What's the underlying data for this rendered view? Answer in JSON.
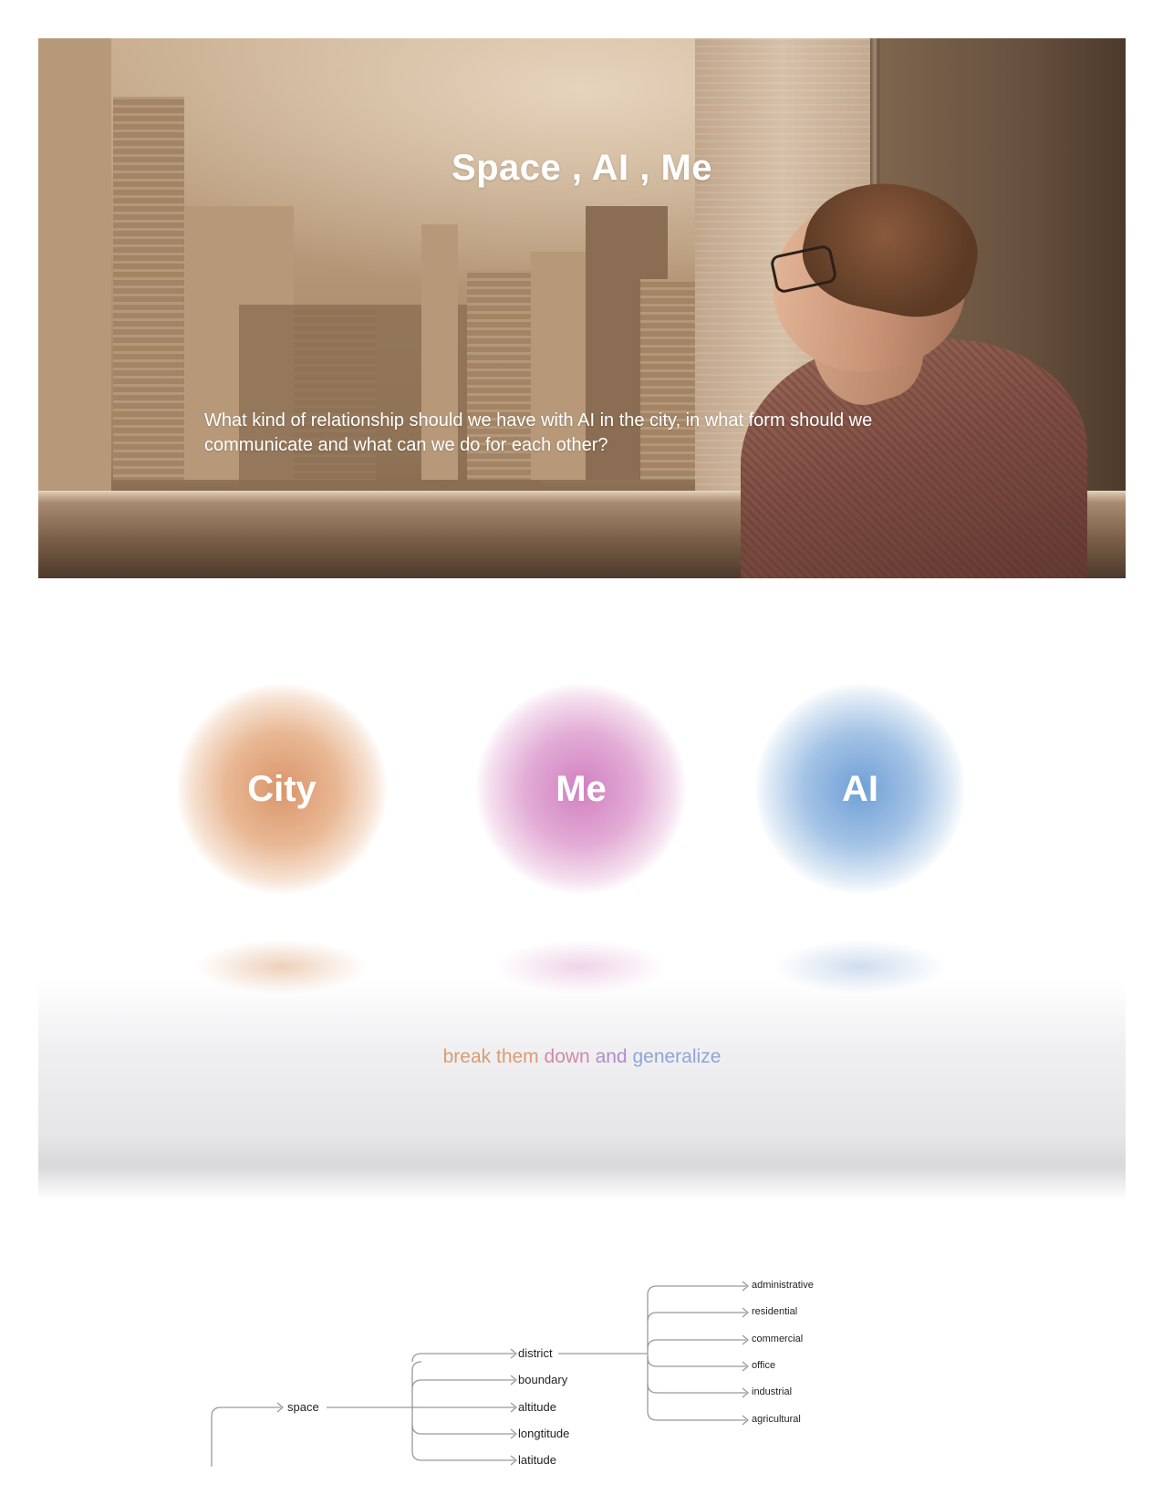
{
  "hero": {
    "title": "Space , AI , Me",
    "question": "What kind of relationship should we have with AI in the city, in what form should we communicate and what can we do for each other?"
  },
  "orbs": [
    {
      "label": "City",
      "color": "#d9956a"
    },
    {
      "label": "Me",
      "color": "#d080c0"
    },
    {
      "label": "AI",
      "color": "#6f9fd6"
    }
  ],
  "tagline": {
    "parts": [
      "break them",
      "down",
      "and",
      "generalize"
    ]
  },
  "tree": {
    "root": "space",
    "children": [
      "district",
      "boundary",
      "altitude",
      "longtitude",
      "latitude"
    ],
    "district_children": [
      "administrative",
      "residential",
      "commercial",
      "office",
      "industrial",
      "agricultural"
    ]
  },
  "colors": {
    "tree_line": "#9a9a9a",
    "hero_text": "#ffffff"
  }
}
